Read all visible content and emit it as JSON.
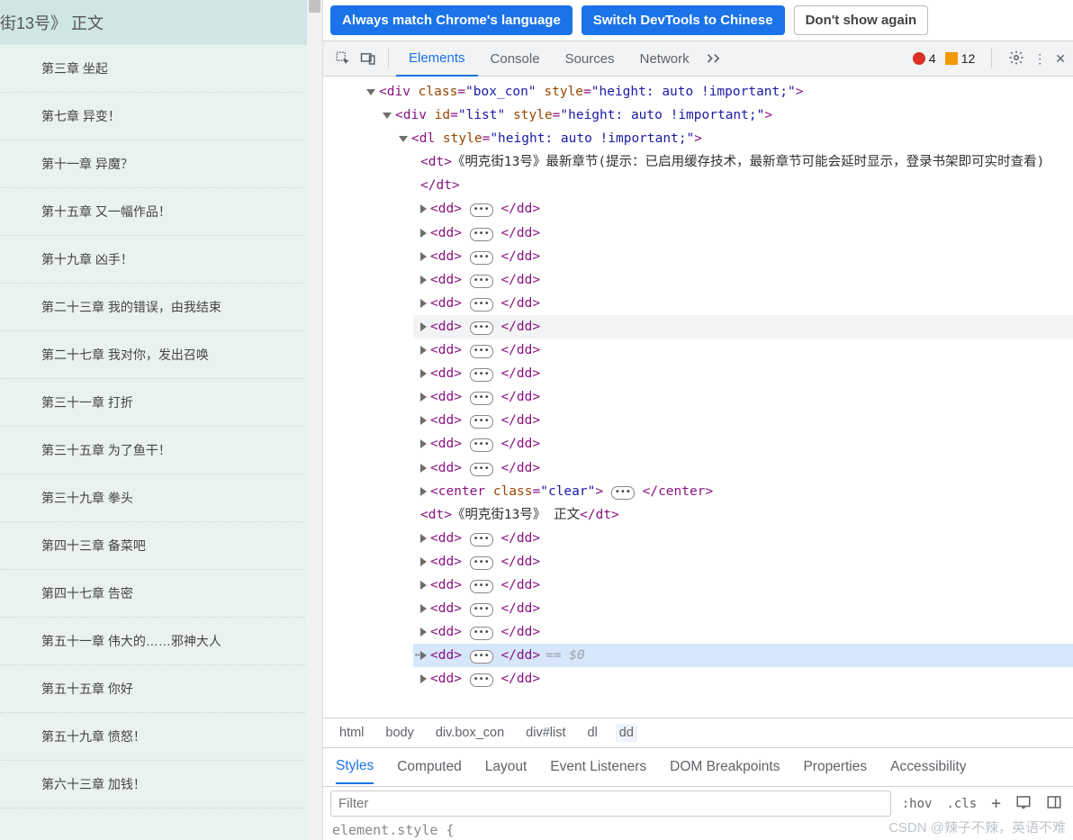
{
  "left_panel": {
    "header": "街13号》 正文",
    "chapters": [
      "第三章 坐起",
      "第七章 异变！",
      "第十一章 异魔？",
      "第十五章 又一幅作品！",
      "第十九章 凶手！",
      "第二十三章 我的错误，由我结束",
      "第二十七章 我对你，发出召唤",
      "第三十一章 打折",
      "第三十五章 为了鱼干！",
      "第三十九章 拳头",
      "第四十三章 备菜吧",
      "第四十七章 告密",
      "第五十一章 伟大的……邪神大人",
      "第五十五章 你好",
      "第五十九章 愤怒！",
      "第六十三章 加钱！"
    ]
  },
  "banner": {
    "match": "Always match Chrome's language",
    "switch": "Switch DevTools to Chinese",
    "dont": "Don't show again"
  },
  "tabs": {
    "elements": "Elements",
    "console": "Console",
    "sources": "Sources",
    "network": "Network"
  },
  "counts": {
    "errors": "4",
    "warnings": "12"
  },
  "dom": {
    "div1": {
      "class_attr": "class",
      "class_val": "\"box_con\"",
      "style_attr": "style",
      "style_val": "\"height: auto !important;\""
    },
    "div2": {
      "id_attr": "id",
      "id_val": "\"list\"",
      "style_attr": "style",
      "style_val": "\"height: auto !important;\""
    },
    "dl": {
      "style_attr": "style",
      "style_val": "\"height: auto !important;\""
    },
    "dt1_text": "《明克街13号》最新章节(提示：已启用缓存技术，最新章节可能会延时显示，登录书架即可实时查看)",
    "center_class_attr": "class",
    "center_class_val": "\"clear\"",
    "dt2_text": "《明克街13号》  正文",
    "eq0": "== $0"
  },
  "crumbs": {
    "html": "html",
    "body": "body",
    "box": "div.box_con",
    "list": "div#list",
    "dl": "dl",
    "dd": "dd"
  },
  "styles_tabs": {
    "styles": "Styles",
    "computed": "Computed",
    "layout": "Layout",
    "event": "Event Listeners",
    "dom": "DOM Breakpoints",
    "props": "Properties",
    "acc": "Accessibility"
  },
  "toolbar": {
    "filter_ph": "Filter",
    "hov": ":hov",
    "cls": ".cls"
  },
  "styles_body": "element.style {",
  "watermark": "CSDN @辣子不辣，英语不难"
}
